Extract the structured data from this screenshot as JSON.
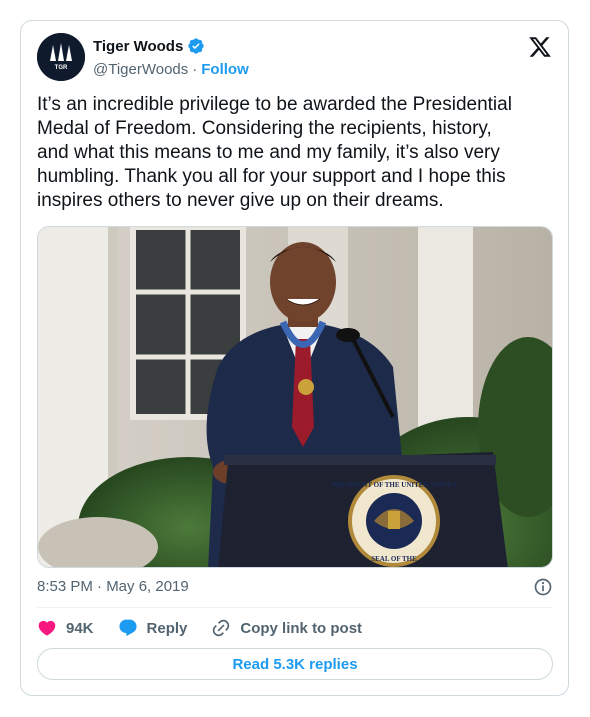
{
  "author": {
    "name": "Tiger Woods",
    "handle": "@TigerWoods",
    "separator": "·",
    "follow_label": "Follow",
    "avatar_text": "TGR",
    "verified_color": "#1d9bf0"
  },
  "tweet": {
    "text": "It’s an incredible privilege to be awarded the Presidential\nMedal of Freedom. Considering the recipients, history,\nand what this means to me and my family, it’s also very\nhumbling. Thank you all for your support and I hope this\ninspires others to never give up on their dreams.",
    "timestamp": "8:53 PM · May 6, 2019"
  },
  "media": {
    "seal_text": "PRESIDENT OF THE UNITED STATES",
    "seal_bottom_text": "SEAL OF THE"
  },
  "actions": {
    "like_count": "94K",
    "reply_label": "Reply",
    "copy_label": "Copy link to post",
    "read_replies_label": "Read 5.3K replies"
  },
  "colors": {
    "accent": "#1d9bf0",
    "like": "#f91880",
    "muted": "#536471"
  },
  "icons": [
    "verified-badge-icon",
    "x-logo-icon",
    "info-icon",
    "heart-icon",
    "reply-bubble-icon",
    "link-icon"
  ]
}
